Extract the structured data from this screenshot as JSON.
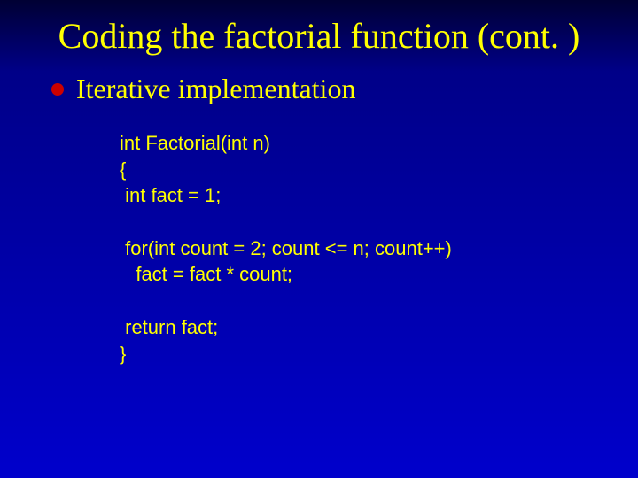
{
  "title": "Coding the factorial function\n(cont. )",
  "bullet": "Iterative implementation",
  "code": "int Factorial(int n)\n{\n int fact = 1;\n\n for(int count = 2; count <= n; count++)\n   fact = fact * count;\n\n return fact;\n}"
}
